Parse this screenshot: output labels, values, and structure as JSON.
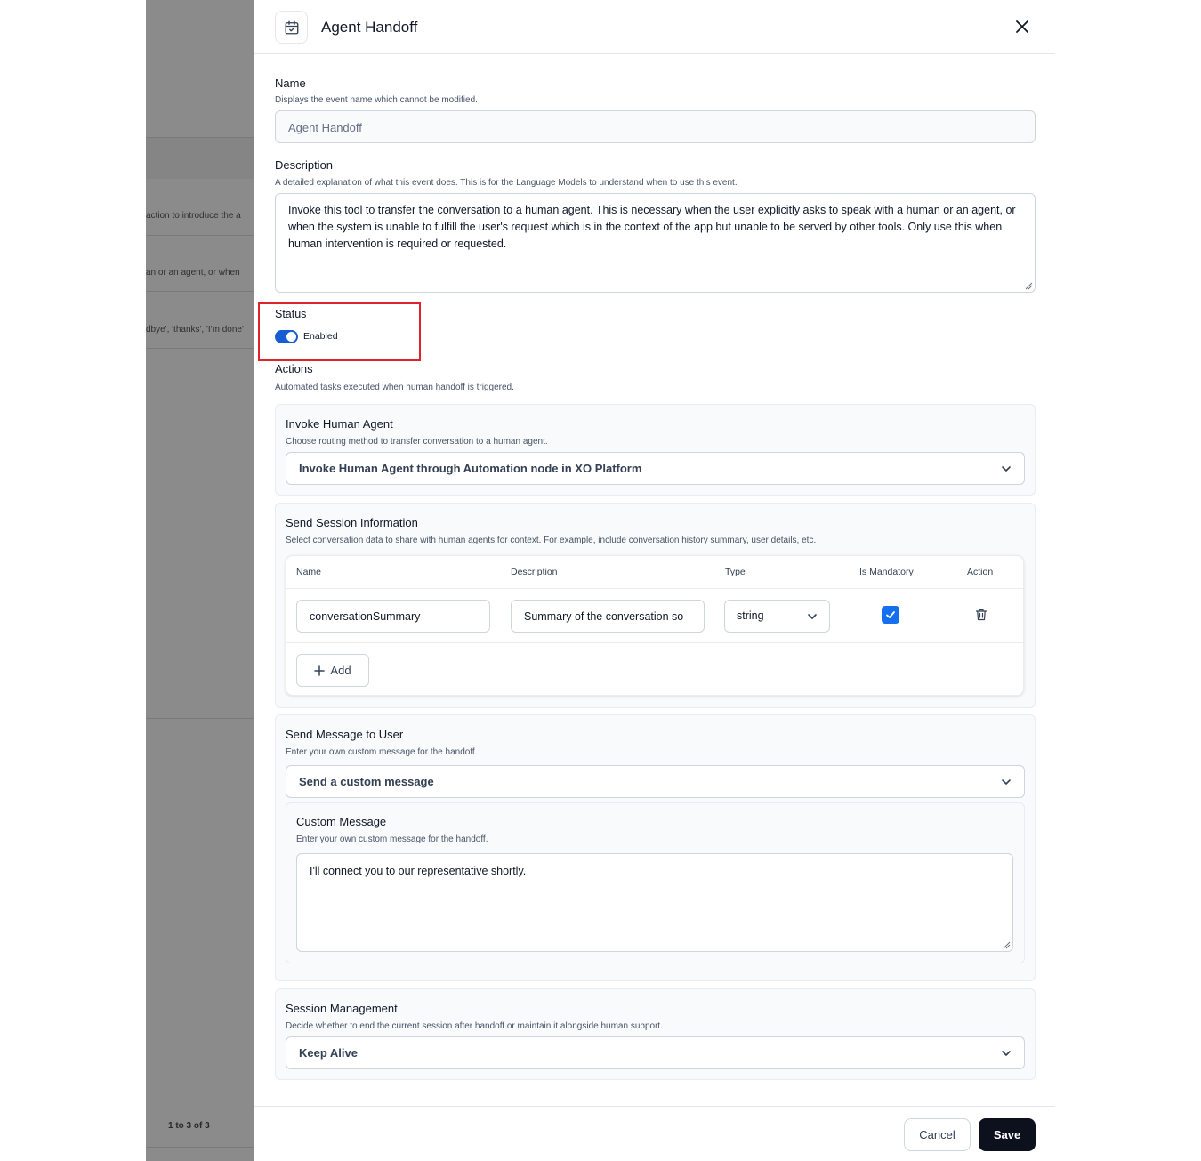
{
  "background": {
    "snippets": [
      "action to introduce the a",
      "an or an agent, or when",
      "dbye', 'thanks', 'I'm done'"
    ],
    "pagination": "1 to 3 of 3"
  },
  "header": {
    "icon": "calendar-event-icon",
    "title": "Agent Handoff",
    "close_icon": "close-icon"
  },
  "name_field": {
    "label": "Name",
    "hint": "Displays the event name which cannot be modified.",
    "value": "Agent Handoff"
  },
  "description_field": {
    "label": "Description",
    "hint": "A detailed explanation of what this event does. This is for the Language Models to understand when to use this event.",
    "value": "Invoke this tool to transfer the conversation to a human agent. This is necessary when the user explicitly asks to speak with a human or an agent, or when the  system is unable to fulfill the user's request which is in the context of the app but unable to be served by other tools. Only use this when human intervention is required or requested."
  },
  "status": {
    "label": "Status",
    "toggle_label": "Enabled",
    "enabled": true,
    "accent_color": "#175cd3",
    "highlight_color": "#e0232b"
  },
  "actions": {
    "label": "Actions",
    "hint": "Automated tasks executed when human handoff is triggered.",
    "invoke_human_agent": {
      "title": "Invoke Human Agent",
      "hint": "Choose routing method to transfer conversation to a human agent.",
      "selected": "Invoke Human Agent through Automation node in XO Platform"
    },
    "send_session_information": {
      "title": "Send Session Information",
      "hint": "Select conversation data to share with human agents for context. For example, include conversation history summary, user details, etc.",
      "columns": [
        "Name",
        "Description",
        "Type",
        "Is Mandatory",
        "Action"
      ],
      "rows": [
        {
          "name": "conversationSummary",
          "description": "Summary of the conversation so",
          "type": "string",
          "mandatory": true
        }
      ],
      "add_label": "Add"
    },
    "send_message_to_user": {
      "title": "Send Message to User",
      "hint": "Enter your own custom message for the handoff.",
      "selected": "Send a custom message",
      "custom_message": {
        "title": "Custom Message",
        "hint": "Enter your own custom message for the handoff.",
        "value": "I'll connect you to our representative shortly."
      }
    },
    "session_management": {
      "title": "Session Management",
      "hint": "Decide whether to end the current session after handoff or maintain it alongside human support.",
      "selected": "Keep Alive"
    }
  },
  "footer": {
    "cancel_label": "Cancel",
    "save_label": "Save"
  }
}
